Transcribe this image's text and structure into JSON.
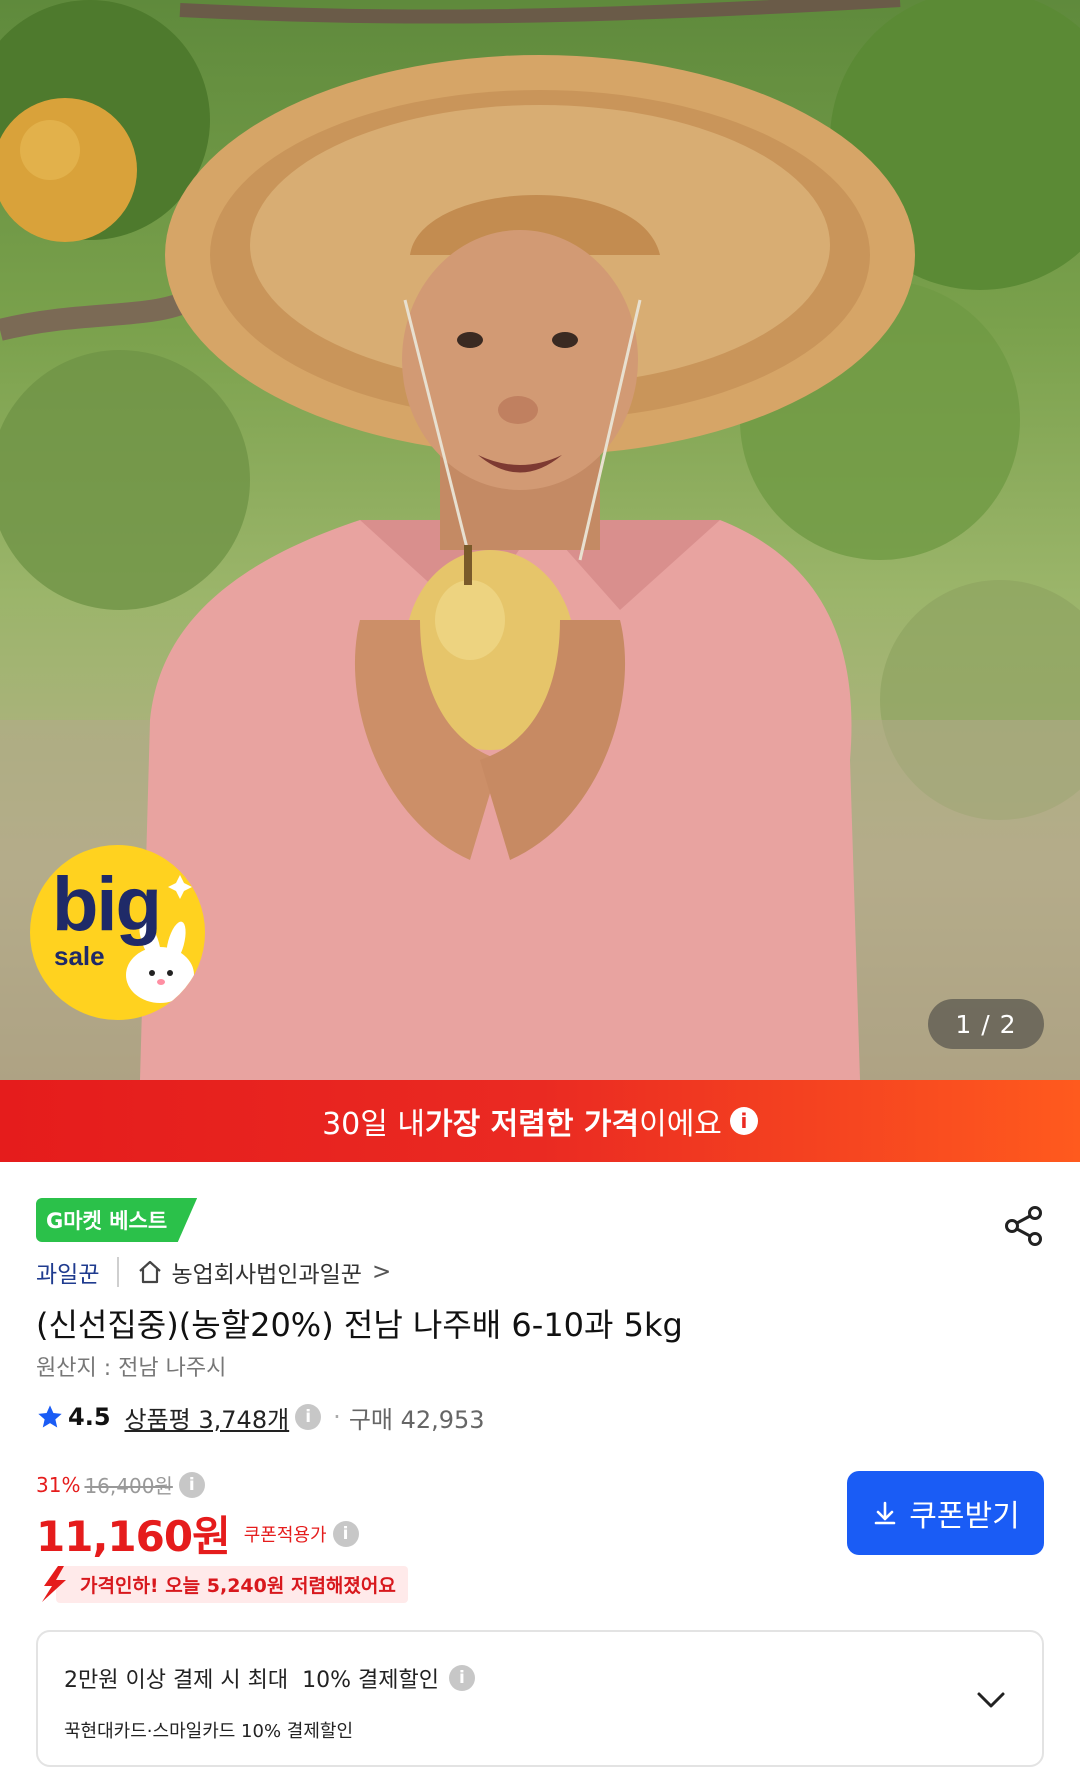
{
  "hero": {
    "badge_big": "big",
    "badge_sale": "sale",
    "counter": "1 / 2"
  },
  "banner": {
    "prefix": "30일 내 ",
    "bold": "가장 저렴한 가격",
    "suffix": "이에요",
    "info": "i"
  },
  "product": {
    "best_tag": "G마켓 베스트",
    "seller": "과일꾼",
    "store": "농업회사법인과일꾼",
    "store_chevron": ">",
    "title": "(신선집중)(농할20%) 전남 나주배 6-10과 5kg",
    "origin": "원산지 : 전남 나주시"
  },
  "rating": {
    "score": "4.5",
    "reviews": "상품평 3,748개",
    "info": "i",
    "dot": "·",
    "purchases": "구매 42,953"
  },
  "price": {
    "discount_pct": "31%",
    "original": "16,400원",
    "info": "i",
    "current": "11,160원",
    "coupon_applied": "쿠폰적용가",
    "drop_notice": "가격인하! 오늘 5,240원 저렴해졌어요"
  },
  "coupon_button": {
    "label": "쿠폰받기"
  },
  "payment": {
    "line1": "2만원 이상 결제 시 최대  10% 결제할인",
    "line2": "꾹현대카드·스마일카드 10% 결제할인",
    "info": "i"
  },
  "colors": {
    "accent_red": "#e51c1c",
    "coupon_blue": "#1a5cf5",
    "best_green": "#2bc14a",
    "seller_blue": "#1f3b8f"
  }
}
